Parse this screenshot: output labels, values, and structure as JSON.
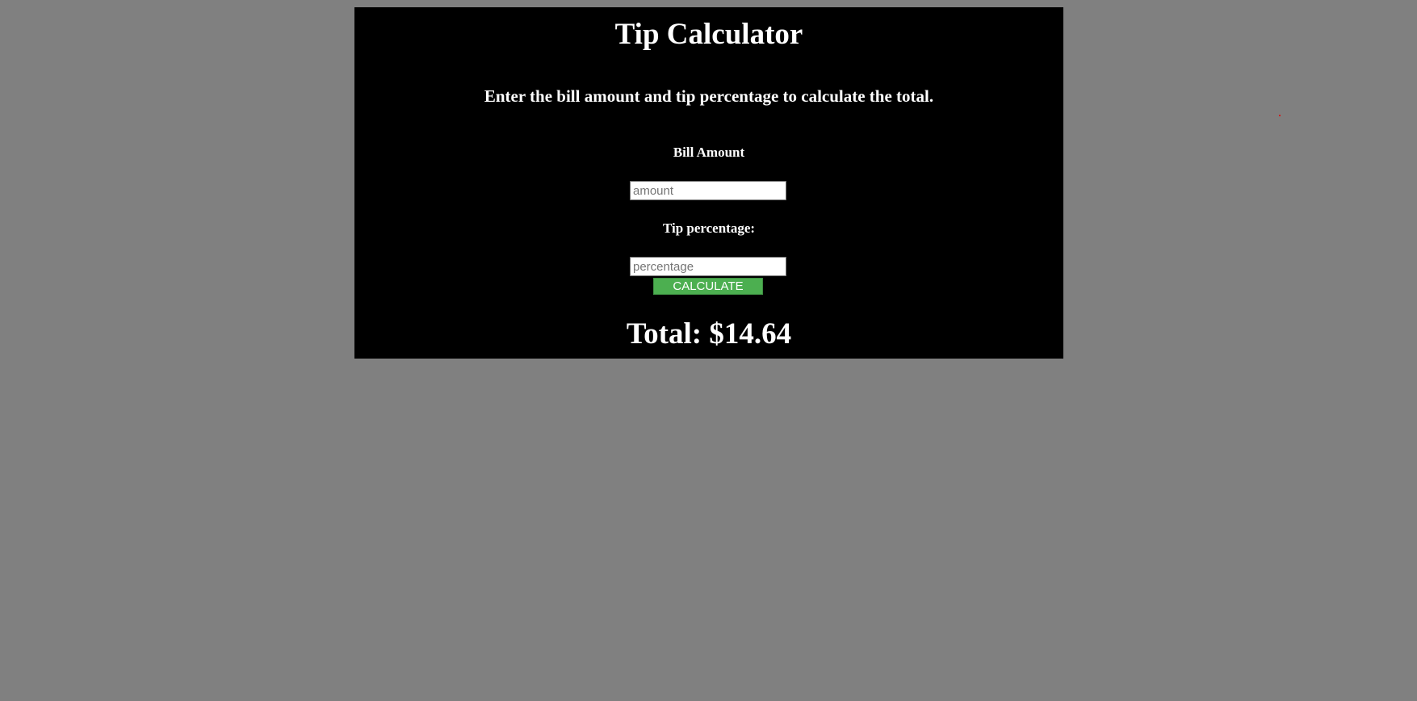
{
  "app": {
    "title": "Tip Calculator",
    "subtitle": "Enter the bill amount and tip percentage to calculate the total."
  },
  "form": {
    "bill": {
      "label": "Bill Amount",
      "placeholder": "amount",
      "value": ""
    },
    "tip": {
      "label": "Tip percentage:",
      "placeholder": "percentage",
      "value": ""
    },
    "calculate_label": "CALCULATE"
  },
  "result": {
    "total_text": "Total: $14.64"
  },
  "colors": {
    "page_background": "#808080",
    "panel_background": "#000000",
    "text": "#ffffff",
    "button_background": "#4caf50"
  }
}
